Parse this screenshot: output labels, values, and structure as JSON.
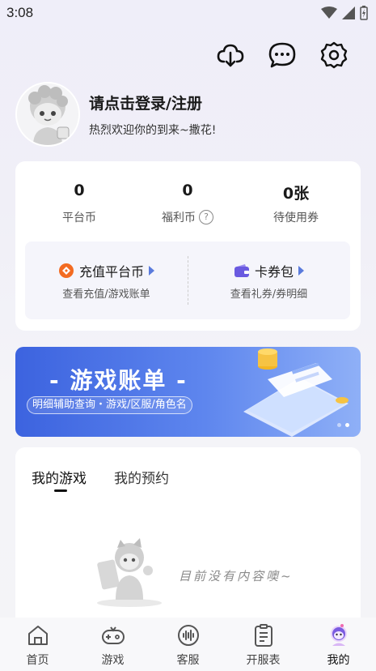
{
  "status_bar": {
    "time": "3:08"
  },
  "header": {
    "icons": [
      "cloud-download-icon",
      "chat-icon",
      "settings-icon"
    ]
  },
  "profile": {
    "login_title": "请点击登录/注册",
    "welcome": "热烈欢迎你的到来~撒花!"
  },
  "wallet": {
    "stats": [
      {
        "value": "0",
        "label": "平台币"
      },
      {
        "value": "0",
        "label": "福利币"
      },
      {
        "value": "0张",
        "label": "待使用券"
      }
    ],
    "recharge": {
      "title": "充值平台币",
      "desc": "查看充值/游戏账单"
    },
    "cards": {
      "title": "卡券包",
      "desc": "查看礼券/券明细"
    }
  },
  "banner": {
    "title": "- 游戏账单 -",
    "subtitle": "明细辅助查询・游戏/区服/角色名"
  },
  "games": {
    "tabs": [
      "我的游戏",
      "我的预约"
    ],
    "active_tab": 0,
    "empty_text": "目前没有内容噢~"
  },
  "bottom_nav": {
    "items": [
      {
        "label": "首页",
        "icon": "home-icon"
      },
      {
        "label": "游戏",
        "icon": "gamepad-icon"
      },
      {
        "label": "客服",
        "icon": "customer-service-icon"
      },
      {
        "label": "开服表",
        "icon": "schedule-icon"
      },
      {
        "label": "我的",
        "icon": "profile-icon"
      }
    ],
    "active": 4
  },
  "colors": {
    "accent": "#3c63df",
    "recharge_icon": "#f36b21",
    "cards_icon": "#6a5ae0",
    "active_nav": "#b34fe0"
  }
}
